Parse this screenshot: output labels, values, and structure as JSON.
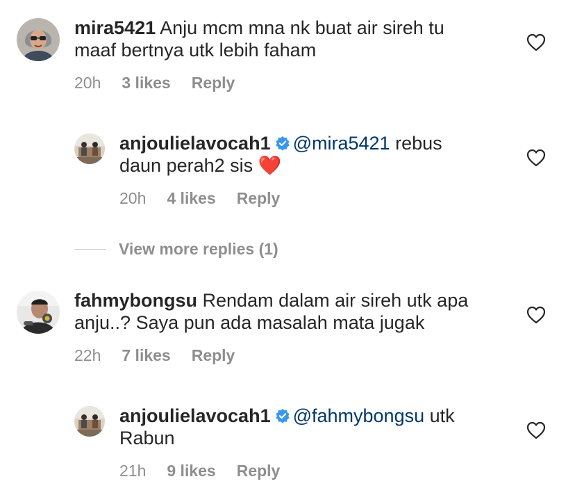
{
  "comments": [
    {
      "username": "mira5421",
      "text_line1": "Anju mcm mna nk buat air sireh tu",
      "text_line2": "maaf bertnya utk lebih faham",
      "time": "20h",
      "likes": "3 likes",
      "reply_label": "Reply"
    },
    {
      "username": "anjoulielavocah1",
      "mention": "@mira5421",
      "text_line1": "rebus",
      "text_line2": "daun perah2 sis",
      "emoji": "❤️",
      "time": "20h",
      "likes": "4 likes",
      "reply_label": "Reply"
    },
    {
      "username": "fahmybongsu",
      "text_line1": "Rendam dalam air sireh utk apa",
      "text_line2": "anju..? Saya pun ada masalah mata jugak",
      "time": "22h",
      "likes": "7 likes",
      "reply_label": "Reply"
    },
    {
      "username": "anjoulielavocah1",
      "mention": "@fahmybongsu",
      "text_line1": "utk",
      "text_line2": "Rabun",
      "time": "21h",
      "likes": "9 likes",
      "reply_label": "Reply"
    }
  ],
  "view_more_replies": "View more replies (1)",
  "colors": {
    "text": "#262626",
    "muted": "#8e8e8e",
    "mention": "#00376b",
    "verified": "#3897f0"
  },
  "icons": {
    "like": "heart-outline-icon",
    "verified": "verified-badge-icon"
  }
}
